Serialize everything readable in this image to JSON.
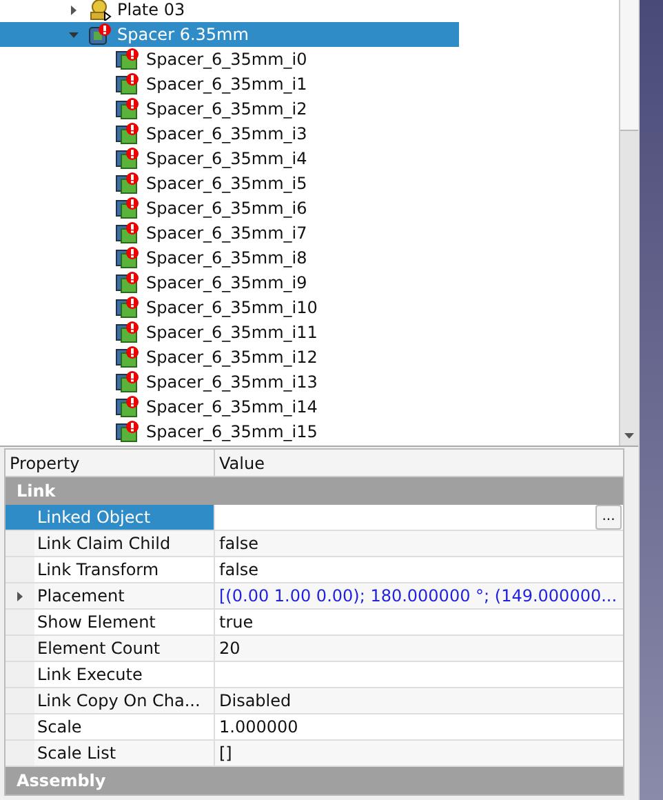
{
  "tree": {
    "items": [
      {
        "label": "Plate 03",
        "kind": "assembly",
        "expanded": false,
        "selected": false
      },
      {
        "label": "Spacer 6.35mm",
        "kind": "link",
        "expanded": true,
        "selected": true,
        "children": [
          {
            "label": "Spacer_6_35mm_i0",
            "kind": "element",
            "selected": false
          },
          {
            "label": "Spacer_6_35mm_i1",
            "kind": "element",
            "selected": false
          },
          {
            "label": "Spacer_6_35mm_i2",
            "kind": "element",
            "selected": false
          },
          {
            "label": "Spacer_6_35mm_i3",
            "kind": "element",
            "selected": false
          },
          {
            "label": "Spacer_6_35mm_i4",
            "kind": "element",
            "selected": false
          },
          {
            "label": "Spacer_6_35mm_i5",
            "kind": "element",
            "selected": false
          },
          {
            "label": "Spacer_6_35mm_i6",
            "kind": "element",
            "selected": false
          },
          {
            "label": "Spacer_6_35mm_i7",
            "kind": "element",
            "selected": false
          },
          {
            "label": "Spacer_6_35mm_i8",
            "kind": "element",
            "selected": false
          },
          {
            "label": "Spacer_6_35mm_i9",
            "kind": "element",
            "selected": false
          },
          {
            "label": "Spacer_6_35mm_i10",
            "kind": "element",
            "selected": false
          },
          {
            "label": "Spacer_6_35mm_i11",
            "kind": "element",
            "selected": false
          },
          {
            "label": "Spacer_6_35mm_i12",
            "kind": "element",
            "selected": false
          },
          {
            "label": "Spacer_6_35mm_i13",
            "kind": "element",
            "selected": false
          },
          {
            "label": "Spacer_6_35mm_i14",
            "kind": "element",
            "selected": false
          },
          {
            "label": "Spacer_6_35mm_i15",
            "kind": "element",
            "selected": false
          }
        ]
      }
    ]
  },
  "property_panel": {
    "columns": [
      "Property",
      "Value"
    ],
    "groups": [
      {
        "name": "Link",
        "properties": [
          {
            "name": "Linked Object",
            "kind": "object",
            "selected": true,
            "button": "..."
          },
          {
            "name": "Link Claim Child",
            "value": "false",
            "kind": "plain",
            "selected": false
          },
          {
            "name": "Link Transform",
            "value": "false",
            "kind": "plain",
            "selected": false
          },
          {
            "name": "Placement",
            "value": "[(0.00 1.00 0.00); 180.000000 °; (149.000000...",
            "kind": "placement",
            "selected": false
          },
          {
            "name": "Show Element",
            "value": "true",
            "kind": "plain",
            "selected": false
          },
          {
            "name": "Element Count",
            "value": "20",
            "kind": "plain",
            "selected": false
          },
          {
            "name": "Link Execute",
            "kind": "plain",
            "selected": false
          },
          {
            "name": "Link Copy On Cha...",
            "value": "Disabled",
            "kind": "plain",
            "selected": false
          },
          {
            "name": "Scale",
            "value": "1.000000",
            "kind": "plain",
            "selected": false
          },
          {
            "name": "Scale List",
            "value": "[]",
            "kind": "plain",
            "selected": false
          }
        ]
      },
      {
        "name": "Assembly"
      }
    ]
  }
}
